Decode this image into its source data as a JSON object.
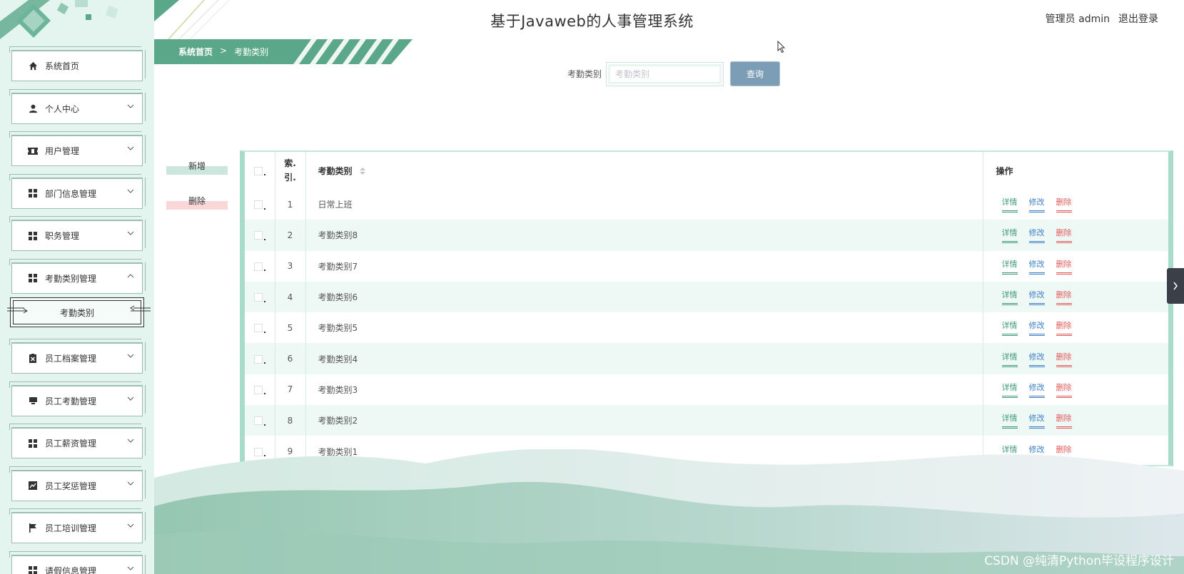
{
  "header": {
    "app_title": "基于Javaweb的人事管理系统",
    "user_label": "管理员 admin",
    "logout_label": "退出登录"
  },
  "breadcrumb": {
    "home": "系统首页",
    "separator": ">",
    "current": "考勤类别"
  },
  "sidebar": {
    "items": [
      {
        "label": "系统首页",
        "icon": "home-icon",
        "expandable": false
      },
      {
        "label": "个人中心",
        "icon": "user-icon",
        "expandable": true
      },
      {
        "label": "用户管理",
        "icon": "ticket-icon",
        "expandable": true
      },
      {
        "label": "部门信息管理",
        "icon": "grid-icon",
        "expandable": true
      },
      {
        "label": "职务管理",
        "icon": "grid-icon",
        "expandable": true
      },
      {
        "label": "考勤类别管理",
        "icon": "grid-icon",
        "expandable": true,
        "expanded": true
      },
      {
        "label": "员工档案管理",
        "icon": "clipboard-icon",
        "expandable": true
      },
      {
        "label": "员工考勤管理",
        "icon": "monitor-icon",
        "expandable": true
      },
      {
        "label": "员工薪资管理",
        "icon": "grid-icon",
        "expandable": true
      },
      {
        "label": "员工奖惩管理",
        "icon": "chart-icon",
        "expandable": true
      },
      {
        "label": "员工培训管理",
        "icon": "flag-icon",
        "expandable": true
      },
      {
        "label": "请假信息管理",
        "icon": "grid-icon",
        "expandable": true
      }
    ],
    "submenu_active": "考勤类别"
  },
  "search": {
    "label": "考勤类别",
    "placeholder": "考勤类别",
    "button": "查询"
  },
  "actions": {
    "add": "新增",
    "delete": "删除"
  },
  "table": {
    "headers": {
      "index": "索引",
      "name": "考勤类别",
      "ops": "操作"
    },
    "op_labels": {
      "detail": "详情",
      "edit": "修改",
      "remove": "删除"
    },
    "rows": [
      {
        "index": "1",
        "name": "日常上班"
      },
      {
        "index": "2",
        "name": "考勤类别8"
      },
      {
        "index": "3",
        "name": "考勤类别7"
      },
      {
        "index": "4",
        "name": "考勤类别6"
      },
      {
        "index": "5",
        "name": "考勤类别5"
      },
      {
        "index": "6",
        "name": "考勤类别4"
      },
      {
        "index": "7",
        "name": "考勤类别3"
      },
      {
        "index": "8",
        "name": "考勤类别2"
      },
      {
        "index": "9",
        "name": "考勤类别1"
      }
    ]
  },
  "watermark": "CSDN @纯清Python毕设程序设计",
  "colors": {
    "sidebar_bg": "#e4f4ef",
    "accent_green": "#5aa889",
    "query_button": "#7b9db5",
    "op_detail": "#3f9a7a",
    "op_edit": "#3d80c7",
    "op_remove": "#e25b5b"
  }
}
